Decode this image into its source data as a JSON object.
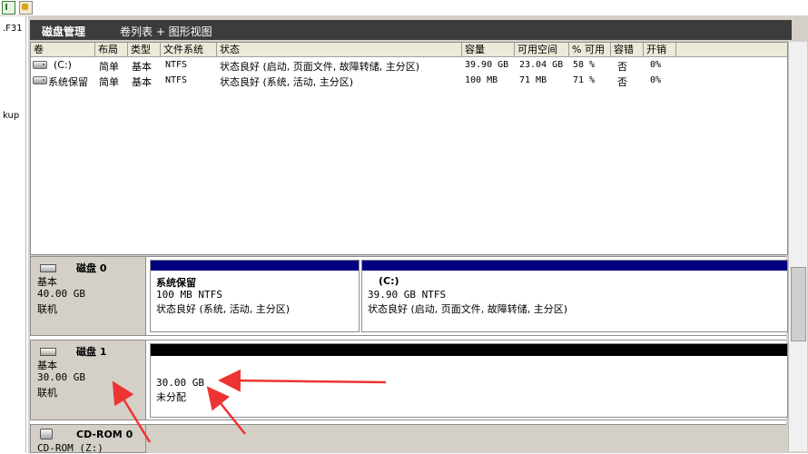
{
  "toolbar": {
    "icon_1": "show-hide-tree-icon",
    "icon_2": "properties-icon"
  },
  "left_tree": {
    "item_1": ".F31",
    "item_2": "kup"
  },
  "title_bar": {
    "title": "磁盘管理",
    "view_label": "卷列表 + 图形视图"
  },
  "volume_list": {
    "columns": [
      "卷",
      "布局",
      "类型",
      "文件系统",
      "状态",
      "容量",
      "可用空间",
      "% 可用",
      "容错",
      "开销"
    ],
    "rows": [
      {
        "volume": "(C:)",
        "layout": "简单",
        "type": "基本",
        "fs": "NTFS",
        "status": "状态良好 (启动, 页面文件, 故障转储, 主分区)",
        "capacity": "39.90 GB",
        "free": "23.04 GB",
        "pct": "58 %",
        "fault": "否",
        "overhead": "0%"
      },
      {
        "volume": "系统保留",
        "layout": "简单",
        "type": "基本",
        "fs": "NTFS",
        "status": "状态良好 (系统, 活动, 主分区)",
        "capacity": "100 MB",
        "free": "71 MB",
        "pct": "71 %",
        "fault": "否",
        "overhead": "0%"
      }
    ]
  },
  "disks": {
    "disk0": {
      "name": "磁盘 0",
      "type": "基本",
      "size": "40.00 GB",
      "state": "联机"
    },
    "disk0_parts": [
      {
        "name": "系统保留",
        "size": "100 MB NTFS",
        "status": "状态良好 (系统, 活动, 主分区)"
      },
      {
        "name": "(C:)",
        "size": "39.90 GB NTFS",
        "status": "状态良好 (启动, 页面文件, 故障转储, 主分区)"
      }
    ],
    "disk1": {
      "name": "磁盘 1",
      "type": "基本",
      "size": "30.00 GB",
      "state": "联机"
    },
    "disk1_unalloc": {
      "size": "30.00 GB",
      "label": "未分配"
    },
    "cdrom": {
      "name": "CD-ROM 0",
      "drive": "CD-ROM (Z:)"
    }
  },
  "colors": {
    "primary_partition": "#000080",
    "unallocated": "#000000",
    "annotation_arrow": "#ee3333"
  }
}
